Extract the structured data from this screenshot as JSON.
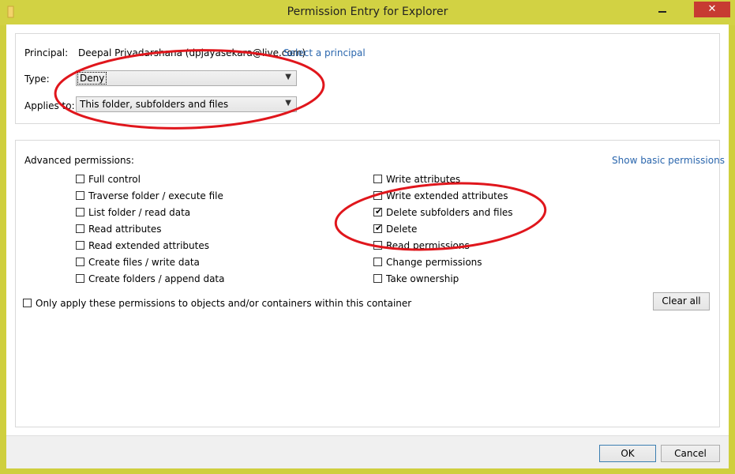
{
  "window": {
    "title": "Permission Entry for Explorer"
  },
  "principal": {
    "label": "Principal:",
    "value": "Deepal Priyadarshana (dpjayasekara@live.com)",
    "link": "Select a principal"
  },
  "type": {
    "label": "Type:",
    "value": "Deny"
  },
  "applies_to": {
    "label": "Applies to:",
    "value": "This folder, subfolders and files"
  },
  "advanced": {
    "title": "Advanced permissions:",
    "show_basic_link": "Show basic permissions",
    "left": [
      {
        "label": "Full control",
        "checked": false
      },
      {
        "label": "Traverse folder / execute file",
        "checked": false
      },
      {
        "label": "List folder / read data",
        "checked": false
      },
      {
        "label": "Read attributes",
        "checked": false
      },
      {
        "label": "Read extended attributes",
        "checked": false
      },
      {
        "label": "Create files / write data",
        "checked": false
      },
      {
        "label": "Create folders / append data",
        "checked": false
      }
    ],
    "right": [
      {
        "label": "Write attributes",
        "checked": false
      },
      {
        "label": "Write extended attributes",
        "checked": false
      },
      {
        "label": "Delete subfolders and files",
        "checked": true
      },
      {
        "label": "Delete",
        "checked": true
      },
      {
        "label": "Read permissions",
        "checked": false
      },
      {
        "label": "Change permissions",
        "checked": false
      },
      {
        "label": "Take ownership",
        "checked": false
      }
    ],
    "only_apply": {
      "label": "Only apply these permissions to objects and/or containers within this container",
      "checked": false
    },
    "clear_all": "Clear all"
  },
  "buttons": {
    "ok": "OK",
    "cancel": "Cancel"
  },
  "colors": {
    "titlebar": "#d2d243",
    "close": "#c73b32",
    "link": "#2a66ad",
    "annotation": "#e0161c"
  }
}
